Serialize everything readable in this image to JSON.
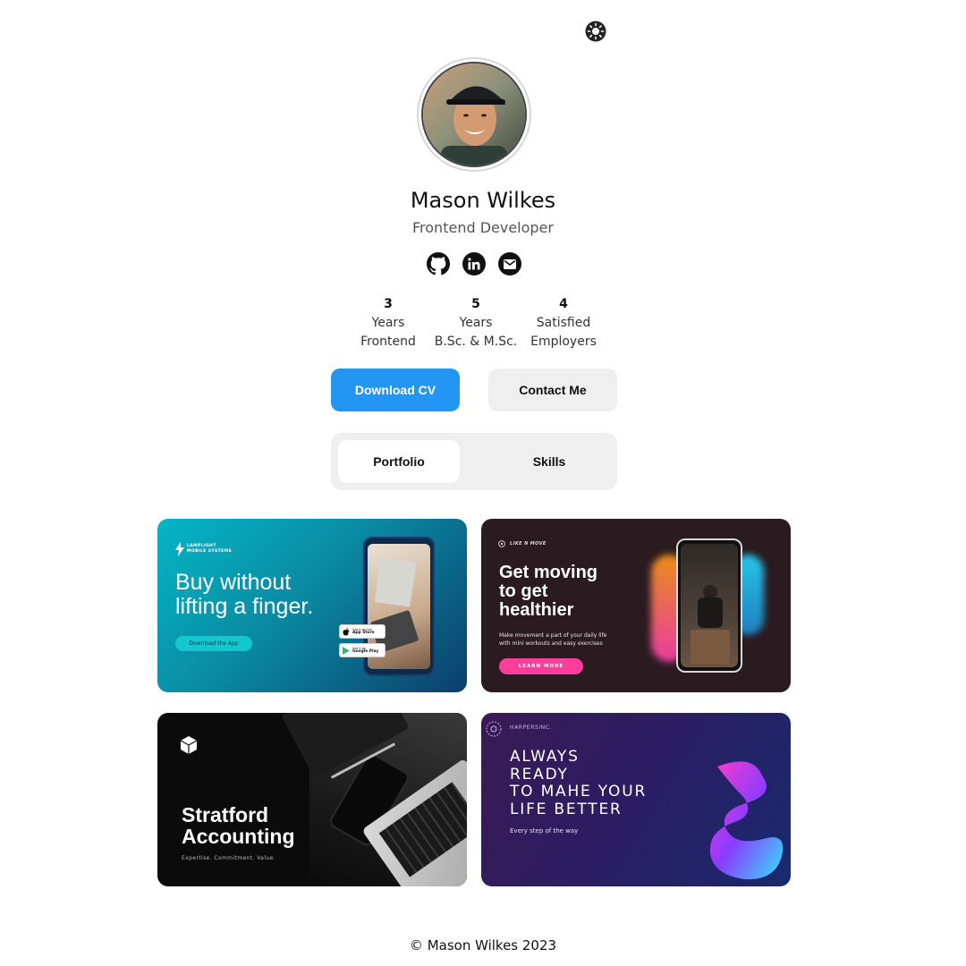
{
  "profile": {
    "name": "Mason Wilkes",
    "role": "Frontend Developer"
  },
  "header": {
    "theme_icon": "sun-icon"
  },
  "socials": [
    {
      "icon": "github-icon"
    },
    {
      "icon": "linkedin-icon"
    },
    {
      "icon": "email-icon"
    }
  ],
  "stats": [
    {
      "value": "3",
      "line1": "Years",
      "line2": "Frontend"
    },
    {
      "value": "5",
      "line1": "Years",
      "line2": "B.Sc. & M.Sc."
    },
    {
      "value": "4",
      "line1": "Satisfied",
      "line2": "Employers"
    }
  ],
  "actions": {
    "download_cv": "Download CV",
    "contact_me": "Contact Me"
  },
  "tabs": [
    {
      "label": "Portfolio",
      "active": true
    },
    {
      "label": "Skills",
      "active": false
    }
  ],
  "portfolio": [
    {
      "brand": "LAMPLIGHT\nMOBILE SYSTEMS",
      "brand_line1": "LAMPLIGHT",
      "brand_line2": "MOBILE SYSTEMS",
      "headline_line1": "Buy without",
      "headline_line2": "lifting a finger.",
      "cta": "Download the App",
      "store1_small": "Get it on the",
      "store1": "App Store",
      "store2_small": "Get it on",
      "store2": "Google Play"
    },
    {
      "brand": "LIKE N MOVE",
      "headline_line1": "Get moving",
      "headline_line2": "to get",
      "headline_line3": "healthier",
      "body_line1": "Make movement a part of your daily life",
      "body_line2": "with mini workouts and easy exercises",
      "cta": "LEARN MORE"
    },
    {
      "headline_line1": "Stratford",
      "headline_line2": "Accounting",
      "tagline": "Expertise. Commitment. Value."
    },
    {
      "brand": "HARPERSINC.",
      "headline_line1": "ALWAYS",
      "headline_line2": "READY",
      "headline_line3": "TO MAHE YOUR",
      "headline_line4": "LIFE BETTER",
      "tagline": "Every step of the way"
    }
  ],
  "footer": {
    "copyright": "© Mason Wilkes 2023"
  },
  "colors": {
    "primary": "#2396f3",
    "secondary_bg": "#efefef",
    "text": "#111111"
  }
}
